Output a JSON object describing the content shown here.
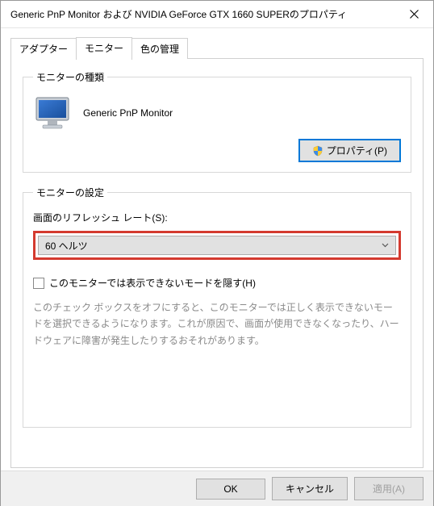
{
  "window": {
    "title": "Generic PnP Monitor および NVIDIA GeForce GTX 1660 SUPERのプロパティ"
  },
  "tabs": {
    "adapter": "アダプター",
    "monitor": "モニター",
    "color": "色の管理"
  },
  "monitor_type": {
    "legend": "モニターの種類",
    "name": "Generic PnP Monitor",
    "properties_button": "プロパティ(P)"
  },
  "monitor_settings": {
    "legend": "モニターの設定",
    "refresh_label": "画面のリフレッシュ レート(S):",
    "refresh_value": "60 ヘルツ",
    "hide_modes_label": "このモニターでは表示できないモードを隠す(H)",
    "help_text": "このチェック ボックスをオフにすると、このモニターでは正しく表示できないモードを選択できるようになります。これが原因で、画面が使用できなくなったり、ハードウェアに障害が発生したりするおそれがあります。"
  },
  "footer": {
    "ok": "OK",
    "cancel": "キャンセル",
    "apply": "適用(A)"
  }
}
